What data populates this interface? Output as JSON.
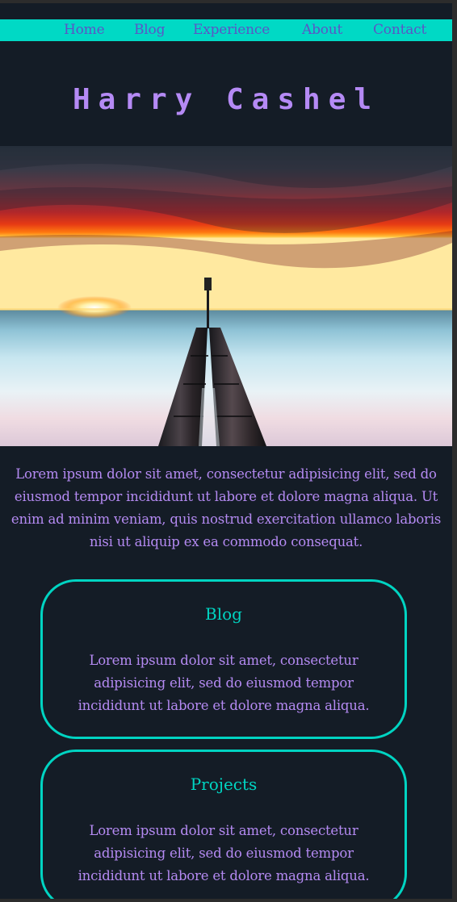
{
  "nav": {
    "items": [
      "Home",
      "Blog",
      "Experience",
      "About",
      "Contact"
    ]
  },
  "header": {
    "title": "Harry Cashel"
  },
  "intro": {
    "text": "Lorem ipsum dolor sit amet, consectetur adipisicing elit, sed do eiusmod tempor incididunt ut labore et dolore magna aliqua. Ut enim ad minim veniam, quis nostrud exercitation ullamco laboris nisi ut aliquip ex ea commodo consequat."
  },
  "cards": [
    {
      "title": "Blog",
      "text": "Lorem ipsum dolor sit amet, consectetur adipisicing elit, sed do eiusmod tempor incididunt ut labore et dolore magna aliqua."
    },
    {
      "title": "Projects",
      "text": "Lorem ipsum dolor sit amet, consectetur adipisicing elit, sed do eiusmod tempor incididunt ut labore et dolore magna aliqua."
    }
  ],
  "colors": {
    "background": "#141c26",
    "nav_bar": "#00d9c5",
    "nav_text": "#5b55c6",
    "accent_purple": "#b48af2",
    "accent_teal": "#00d4c2"
  }
}
